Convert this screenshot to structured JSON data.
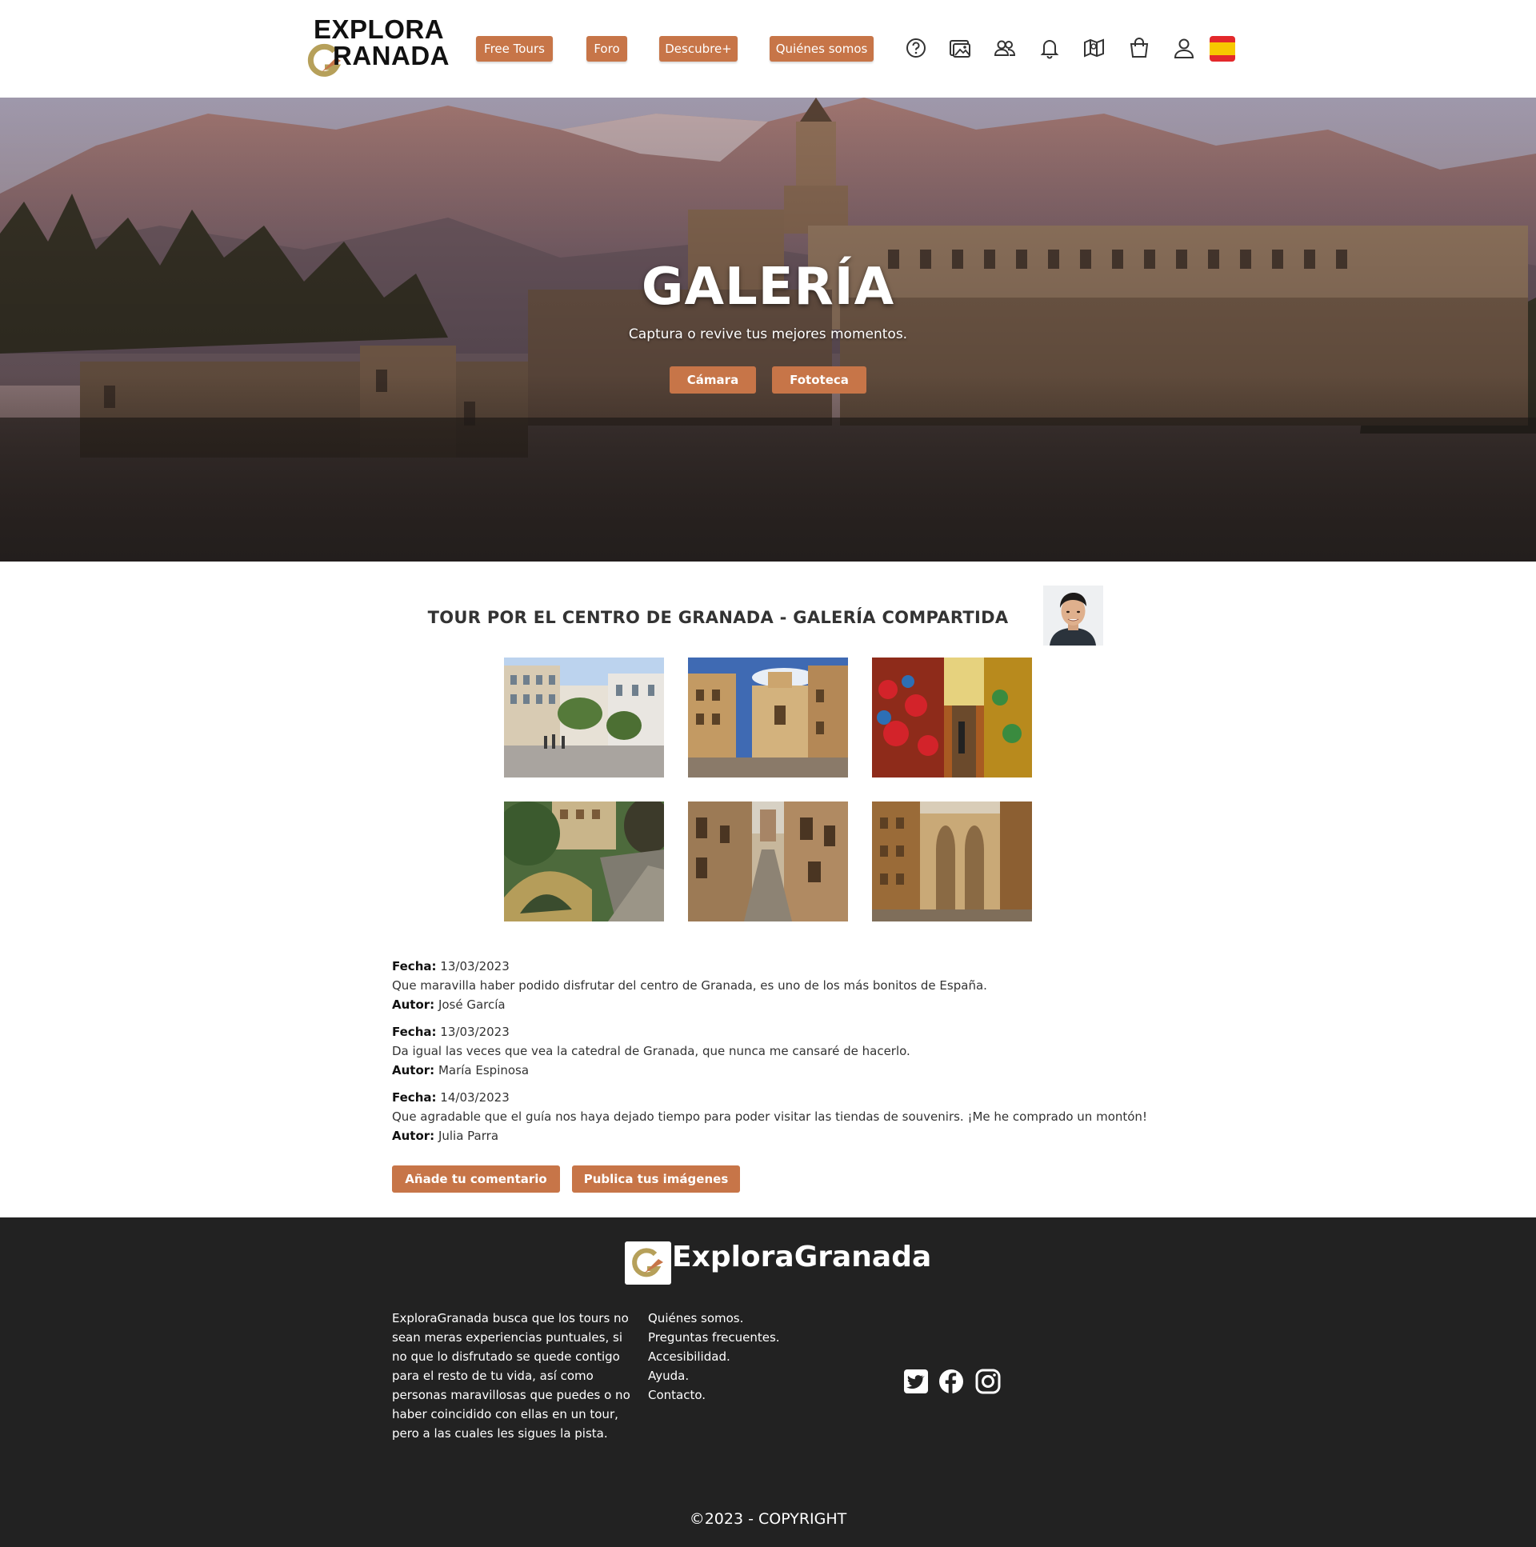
{
  "header": {
    "logo_line1": "EXPLORA",
    "logo_line2": "RANADA",
    "nav": [
      "Free Tours",
      "Foro",
      "Descubre+",
      "Quiénes somos"
    ],
    "icons": [
      "help-icon",
      "gallery-icon",
      "community-icon",
      "notifications-icon",
      "map-icon",
      "shopping-bag-icon",
      "user-icon",
      "spain-flag-icon"
    ]
  },
  "hero": {
    "title": "GALERÍA",
    "subtitle": "Captura o revive tus mejores momentos.",
    "buttons": [
      "Cámara",
      "Fototeca"
    ]
  },
  "gallery": {
    "title": "TOUR POR EL CENTRO DE GRANADA - GALERÍA COMPARTIDA",
    "photos": [
      "plaza-photo",
      "cathedral-street-photo",
      "souvenir-market-photo",
      "river-bridge-photo",
      "narrow-street-photo",
      "cathedral-facade-photo"
    ]
  },
  "comments": [
    {
      "date_label": "Fecha:",
      "date": "13/03/2023",
      "text": "Que maravilla haber podido disfrutar del centro de Granada, es uno de los más bonitos de España.",
      "author_label": "Autor:",
      "author": "José García"
    },
    {
      "date_label": "Fecha:",
      "date": "13/03/2023",
      "text": "Da igual las veces que vea la catedral de Granada, que nunca me cansaré de hacerlo.",
      "author_label": "Autor:",
      "author": "María Espinosa"
    },
    {
      "date_label": "Fecha:",
      "date": "14/03/2023",
      "text": "Que agradable que el guía nos haya dejado tiempo para poder visitar las tiendas de souvenirs. ¡Me he comprado un montón!",
      "author_label": "Autor:",
      "author": "Julia Parra"
    }
  ],
  "actions": [
    "Añade tu comentario",
    "Publica tus imágenes"
  ],
  "footer": {
    "brand": "ExploraGranada",
    "description": "ExploraGranada busca que los tours no sean meras experiencias puntuales, si no que lo disfrutado se quede contigo para el resto de tu vida, así como personas maravillosas que puedes o no haber coincidido con ellas en un tour, pero a las cuales les sigues la pista.",
    "links": [
      "Quiénes somos.",
      "Preguntas frecuentes.",
      "Accesibilidad.",
      "Ayuda.",
      "Contacto."
    ],
    "social": [
      "twitter-icon",
      "facebook-icon",
      "instagram-icon"
    ],
    "copyright": "©2023 - COPYRIGHT"
  },
  "colors": {
    "accent": "#c77548",
    "footer_bg": "#222222"
  }
}
